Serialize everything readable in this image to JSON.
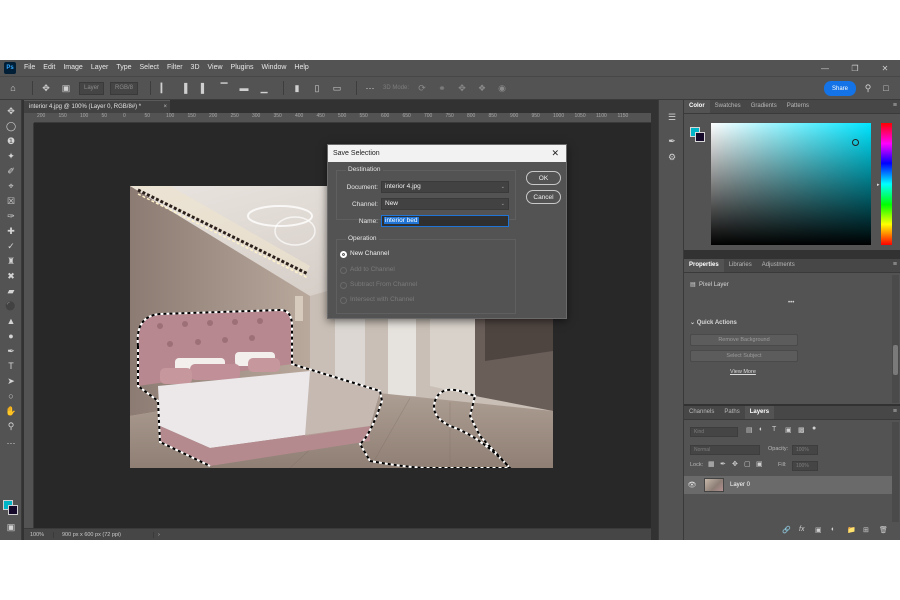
{
  "menu": [
    "File",
    "Edit",
    "Image",
    "Layer",
    "Type",
    "Select",
    "Filter",
    "3D",
    "View",
    "Plugins",
    "Window",
    "Help"
  ],
  "app_logo": "Ps",
  "options_bar": {
    "layer_field": "Layer",
    "color_field": "RGB/8",
    "mode_3d": "3D Mode:",
    "share_label": "Share"
  },
  "document": {
    "tab_title": "interior 4.jpg @ 100% (Layer 0, RGB/8#) *",
    "zoom": "100%",
    "info": "900 px x 600 px (72 ppi)",
    "ruler_ticks": [
      "200",
      "150",
      "100",
      "50",
      "0",
      "50",
      "100",
      "150",
      "200",
      "250",
      "300",
      "350",
      "400",
      "450",
      "500",
      "550",
      "600",
      "650",
      "700",
      "750",
      "800",
      "850",
      "900",
      "950",
      "1000",
      "1050",
      "1100",
      "1150"
    ]
  },
  "dialog": {
    "title": "Save Selection",
    "destination_label": "Destination",
    "document_label": "Document:",
    "document_value": "interior 4.jpg",
    "channel_label": "Channel:",
    "channel_value": "New",
    "name_label": "Name:",
    "name_value": "interior bed",
    "ok_label": "OK",
    "cancel_label": "Cancel",
    "operation_label": "Operation",
    "operations": [
      {
        "label": "New Channel",
        "selected": true,
        "enabled": true
      },
      {
        "label": "Add to Channel",
        "selected": false,
        "enabled": false
      },
      {
        "label": "Subtract From Channel",
        "selected": false,
        "enabled": false
      },
      {
        "label": "Intersect with Channel",
        "selected": false,
        "enabled": false
      }
    ]
  },
  "color_panel": {
    "tabs": [
      "Color",
      "Swatches",
      "Gradients",
      "Patterns"
    ],
    "foreground": "#00b4c8",
    "background": "#160a2a"
  },
  "properties_panel": {
    "tabs": [
      "Properties",
      "Libraries",
      "Adjustments"
    ],
    "layer_type": "Pixel Layer",
    "more": "•••",
    "quick_actions": "Quick Actions",
    "remove_background": "Remove Background",
    "select_subject": "Select Subject",
    "view_more": "View More"
  },
  "layers_panel": {
    "tabs": [
      "Channels",
      "Paths",
      "Layers"
    ],
    "kind_filter": "Kind",
    "blend_mode": "Normal",
    "opacity_label": "Opacity:",
    "opacity_value": "100%",
    "lock_label": "Lock:",
    "fill_label": "Fill:",
    "fill_value": "100%",
    "layer_name": "Layer 0"
  }
}
